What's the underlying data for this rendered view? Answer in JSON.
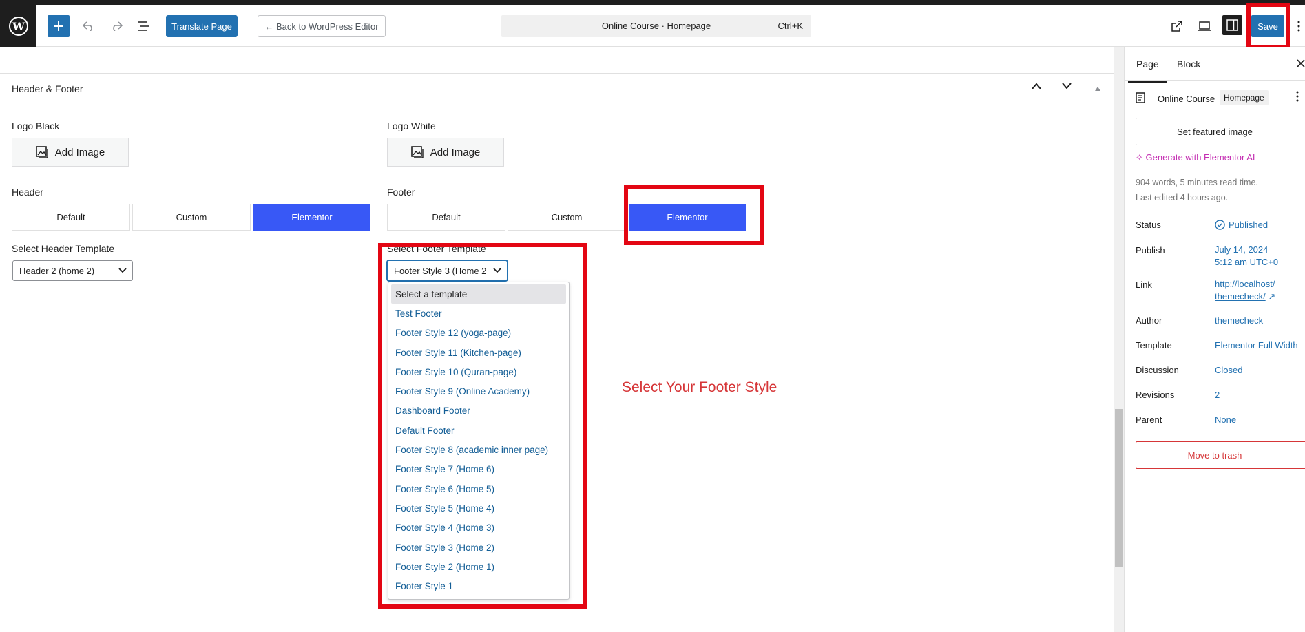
{
  "topbar": {
    "translate_label": "Translate Page",
    "back_label": "← Back to WordPress Editor",
    "doc_title": "Online Course · Homepage",
    "shortcut": "Ctrl+K",
    "save_label": "Save"
  },
  "main": {
    "section_title": "Header & Footer",
    "logo_black_label": "Logo Black",
    "logo_white_label": "Logo White",
    "add_image_label": "Add Image",
    "header_label": "Header",
    "footer_label": "Footer",
    "header_options": [
      "Default",
      "Custom",
      "Elementor"
    ],
    "footer_options": [
      "Default",
      "Custom",
      "Elementor"
    ],
    "header_active": "Elementor",
    "footer_active": "Elementor",
    "header_template_label": "Select Header Template",
    "header_template_value": "Header 2 (home 2)",
    "footer_template_label": "Select Footer Template",
    "footer_template_value": "Footer Style 3 (Home 2",
    "footer_dropdown_options": [
      "Select a template",
      "Test Footer",
      "Footer Style 12 (yoga-page)",
      "Footer Style 11 (Kitchen-page)",
      "Footer Style 10 (Quran-page)",
      "Footer Style 9 (Online Academy)",
      "Dashboard Footer",
      "Default Footer",
      "Footer Style 8 (academic inner page)",
      "Footer Style 7 (Home 6)",
      "Footer Style 6 (Home 5)",
      "Footer Style 5 (Home 4)",
      "Footer Style 4 (Home 3)",
      "Footer Style 3 (Home 2)",
      "Footer Style 2 (Home 1)",
      "Footer Style 1"
    ],
    "annotation": "Select Your Footer Style"
  },
  "sidebar": {
    "tabs": [
      "Page",
      "Block"
    ],
    "doc_name": "Online Course",
    "doc_chip": "Homepage",
    "featured_label": "Set featured image",
    "ai_label": "Generate with Elementor AI",
    "meta_words": "904 words, 5 minutes read time.",
    "meta_edited": "Last edited 4 hours ago.",
    "rows": {
      "status_label": "Status",
      "status_value": "Published",
      "publish_label": "Publish",
      "publish_value_1": "July 14, 2024",
      "publish_value_2": "5:12 am UTC+0",
      "link_label": "Link",
      "link_value_1": "http://localhost/",
      "link_value_2": "themecheck/",
      "author_label": "Author",
      "author_value": "themecheck",
      "template_label": "Template",
      "template_value": "Elementor Full Width",
      "discussion_label": "Discussion",
      "discussion_value": "Closed",
      "revisions_label": "Revisions",
      "revisions_value": "2",
      "parent_label": "Parent",
      "parent_value": "None"
    },
    "trash_label": "Move to trash"
  },
  "colors": {
    "accent": "#2271b1",
    "elementor_active": "#3858f6",
    "annotation_red": "#e30613"
  }
}
